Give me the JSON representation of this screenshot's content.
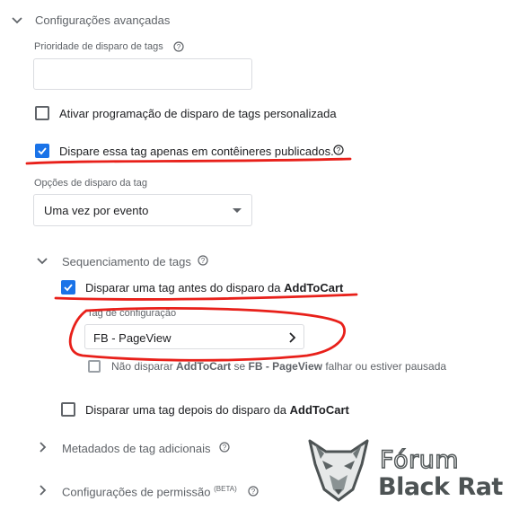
{
  "advanced": {
    "title": "Configurações avançadas",
    "priority_label": "Prioridade de disparo de tags",
    "priority_value": "",
    "custom_schedule_label": "Ativar programação de disparo de tags personalizada",
    "custom_schedule_checked": false,
    "published_only_label": "Dispare essa tag apenas em contêineres publicados.",
    "published_only_checked": true,
    "firing_options_label": "Opções de disparo da tag",
    "firing_option_selected": "Uma vez por evento"
  },
  "sequencing": {
    "title": "Sequenciamento de tags",
    "before_prefix": "Disparar uma tag antes do disparo da ",
    "before_tag": "AddToCart",
    "before_checked": true,
    "setup_tag_label": "Tag de configuração",
    "setup_tag_value": "FB - PageView",
    "dont_fire_text_1": "Não disparar ",
    "dont_fire_tag": "AddToCart",
    "dont_fire_text_2": " se ",
    "dont_fire_setup": "FB - PageView",
    "dont_fire_text_3": " falhar ou estiver pausada",
    "dont_fire_checked": false,
    "after_prefix": "Disparar uma tag depois do disparo da ",
    "after_tag": "AddToCart",
    "after_checked": false
  },
  "metadata": {
    "title": "Metadados de tag adicionais"
  },
  "permissions": {
    "title": "Configurações de permissão",
    "badge": "(BETA)"
  },
  "watermark": {
    "line1": "Fórum",
    "line2": "Black Rat"
  },
  "colors": {
    "accent": "#1a73e8",
    "annotation": "#e8201a"
  }
}
